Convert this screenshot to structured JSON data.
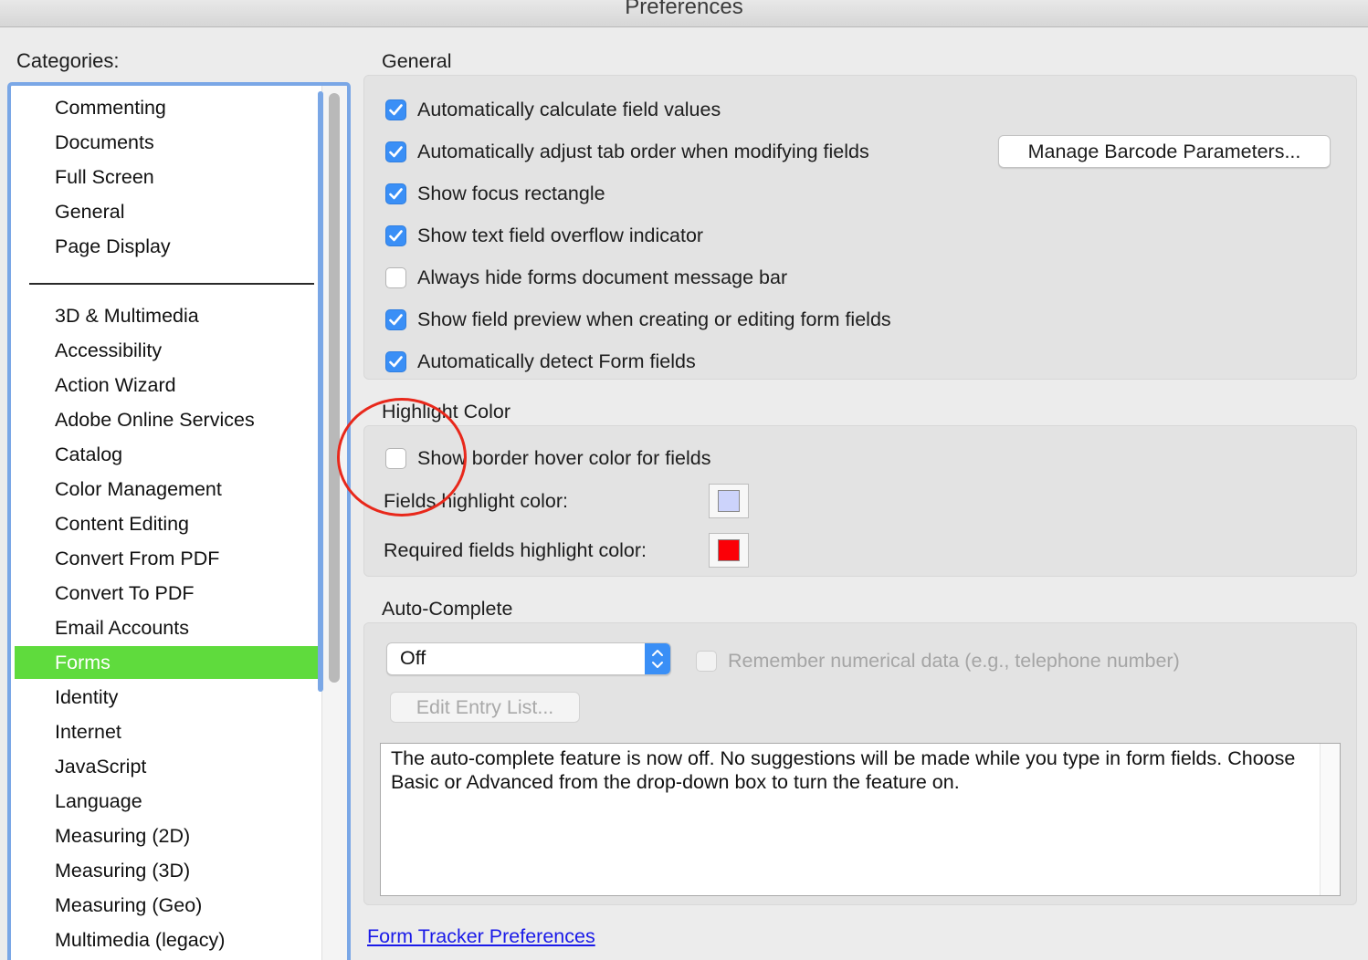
{
  "window": {
    "title": "Preferences"
  },
  "sidebar": {
    "label": "Categories:",
    "items": [
      {
        "label": "Commenting"
      },
      {
        "label": "Documents"
      },
      {
        "label": "Full Screen"
      },
      {
        "label": "General"
      },
      {
        "label": "Page Display"
      },
      {
        "label": "3D & Multimedia"
      },
      {
        "label": "Accessibility"
      },
      {
        "label": "Action Wizard"
      },
      {
        "label": "Adobe Online Services"
      },
      {
        "label": "Catalog"
      },
      {
        "label": "Color Management"
      },
      {
        "label": "Content Editing"
      },
      {
        "label": "Convert From PDF"
      },
      {
        "label": "Convert To PDF"
      },
      {
        "label": "Email Accounts"
      },
      {
        "label": "Forms"
      },
      {
        "label": "Identity"
      },
      {
        "label": "Internet"
      },
      {
        "label": "JavaScript"
      },
      {
        "label": "Language"
      },
      {
        "label": "Measuring (2D)"
      },
      {
        "label": "Measuring (3D)"
      },
      {
        "label": "Measuring (Geo)"
      },
      {
        "label": "Multimedia (legacy)"
      }
    ],
    "selected": "Forms"
  },
  "general": {
    "title": "General",
    "options": [
      {
        "label": "Automatically calculate field values",
        "checked": true
      },
      {
        "label": "Automatically adjust tab order when modifying fields",
        "checked": true
      },
      {
        "label": "Show focus rectangle",
        "checked": true
      },
      {
        "label": "Show text field overflow indicator",
        "checked": true
      },
      {
        "label": "Always hide forms document message bar",
        "checked": false
      },
      {
        "label": "Show field preview when creating or editing form fields",
        "checked": true
      },
      {
        "label": "Automatically detect Form fields",
        "checked": true
      }
    ],
    "barcode_button": "Manage Barcode Parameters..."
  },
  "highlight": {
    "title": "Highlight Color",
    "hover_option": {
      "label": "Show border hover color for fields",
      "checked": false
    },
    "fields_label": "Fields highlight color:",
    "fields_color": "#ccd3fb",
    "required_label": "Required fields highlight color:",
    "required_color": "#fb0007"
  },
  "autocomplete": {
    "title": "Auto-Complete",
    "selected": "Off",
    "remember_option": {
      "label": "Remember numerical data (e.g., telephone number)",
      "checked": false,
      "enabled": false
    },
    "edit_button": "Edit Entry List...",
    "info_text": "The auto-complete feature is now off. No suggestions will be made while you type in form fields. Choose Basic or Advanced from the drop-down box to turn the feature on."
  },
  "footer": {
    "link": "Form Tracker Preferences"
  },
  "colors": {
    "accent": "#3a8ff6",
    "selection": "#5fdb3d",
    "annotation": "#e8281b",
    "link": "#1a1ae8"
  }
}
